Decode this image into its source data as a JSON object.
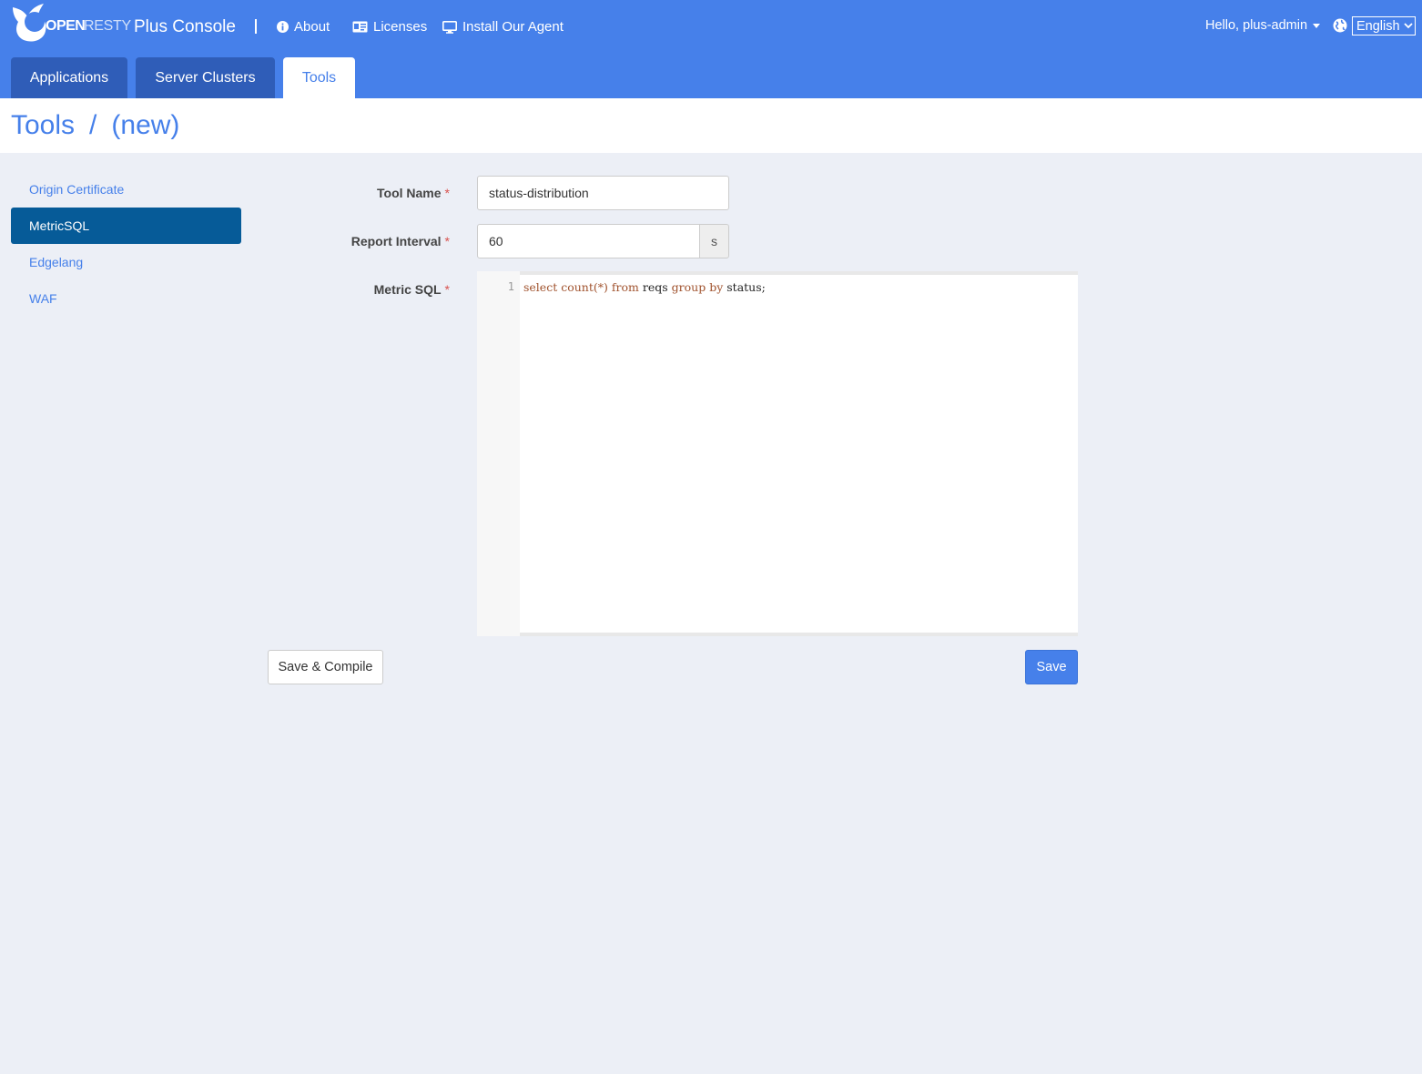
{
  "header": {
    "logo_open": "OPEN",
    "logo_resty": "RESTY",
    "app_title": "Plus Console",
    "nav": [
      {
        "label": "About",
        "icon": "info-icon"
      },
      {
        "label": "Licenses",
        "icon": "id-card-icon"
      },
      {
        "label": "Install Our Agent",
        "icon": "monitor-icon"
      }
    ],
    "user_greeting": "Hello, plus-admin",
    "language": "English"
  },
  "tabs": [
    {
      "label": "Applications",
      "active": false
    },
    {
      "label": "Server Clusters",
      "active": false
    },
    {
      "label": "Tools",
      "active": true
    }
  ],
  "breadcrumb": {
    "section": "Tools",
    "separator": "/",
    "item": "(new)"
  },
  "sidebar": {
    "items": [
      {
        "label": "Origin Certificate",
        "active": false
      },
      {
        "label": "MetricSQL",
        "active": true
      },
      {
        "label": "Edgelang",
        "active": false
      },
      {
        "label": "WAF",
        "active": false
      }
    ]
  },
  "form": {
    "tool_name": {
      "label": "Tool Name",
      "required": "*",
      "value": "status-distribution"
    },
    "report_interval": {
      "label": "Report Interval",
      "required": "*",
      "value": "60",
      "unit": "s"
    },
    "metric_sql": {
      "label": "Metric SQL",
      "required": "*",
      "lines": [
        {
          "number": "1",
          "code": "select count(*) from reqs group by status;"
        }
      ]
    }
  },
  "actions": {
    "save_compile": "Save & Compile",
    "save": "Save"
  },
  "colors": {
    "brand": "#4680ea",
    "tab_dark": "#2f5db8",
    "sidebar_active": "#065b98",
    "background": "#eceff6",
    "required": "#d9534f"
  }
}
